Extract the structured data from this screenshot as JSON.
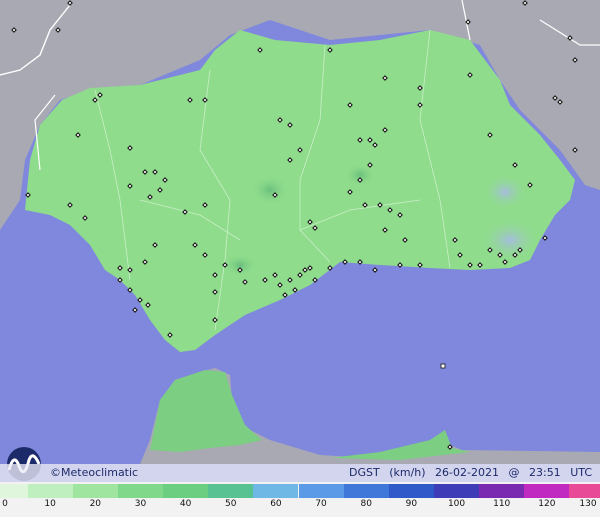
{
  "branding": {
    "copyright": "©",
    "name": "Meteoclimatic",
    "logo_icon": "meteoclimatic-wave-logo-icon"
  },
  "map_info": {
    "variable": "DGST",
    "unit": "(km/h)",
    "date": "26-02-2021",
    "at": "@",
    "time": "23:51",
    "timezone": "UTC"
  },
  "scale": {
    "ticks": [
      "0",
      "10",
      "20",
      "30",
      "40",
      "50",
      "60",
      "70",
      "80",
      "90",
      "100",
      "110",
      "120",
      "130"
    ],
    "colors": [
      "#dff5dc",
      "#bfefbe",
      "#9fe59f",
      "#80d98a",
      "#6bce80",
      "#58c292",
      "#6fb8e6",
      "#5a9ae6",
      "#3f78d8",
      "#2f58c8",
      "#3f3cb8",
      "#7a2ab0",
      "#c02ac0",
      "#e84a98"
    ]
  },
  "colors": {
    "sea": "#7f88dc",
    "land_andalusia": "#8fdc8c",
    "land_other": "#a9a9b3",
    "station_marker": "#111111"
  }
}
